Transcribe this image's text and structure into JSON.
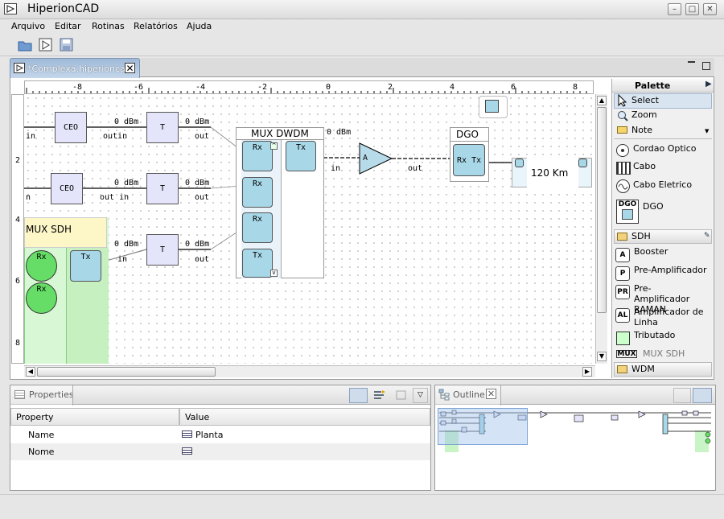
{
  "window": {
    "title": "HiperionCAD"
  },
  "menu": {
    "items": [
      "Arquivo",
      "Editar",
      "Rotinas",
      "Relatórios",
      "Ajuda"
    ]
  },
  "editor": {
    "tab_label": "*Complexa.hiperioncad"
  },
  "ruler": {
    "h_ticks": [
      "-8",
      "-6",
      "-4",
      "-2",
      "0",
      "2",
      "4",
      "6",
      "8"
    ],
    "v_ticks": [
      "2",
      "4",
      "6",
      "8"
    ]
  },
  "diagram": {
    "ceo_label": "CEO",
    "t_label": "T",
    "power": "0 dBm",
    "in": "in",
    "out": "out",
    "outin": "outin",
    "out_in": "out in",
    "n": "n",
    "mux_dwdm": "MUX DWDM",
    "mux_sdh": "MUX SDH",
    "rx": "Rx",
    "tx": "Tx",
    "amp": "A",
    "dgo": "DGO",
    "fiber": "120 Km"
  },
  "palette": {
    "title": "Palette",
    "tools": [
      "Select",
      "Zoom",
      "Note"
    ],
    "items": [
      "Cordao Optico",
      "Cabo",
      "Cabo Eletrico",
      "DGO"
    ],
    "drawer_sdh": "SDH",
    "sdh_items": [
      "Booster",
      "Pre-Amplificador",
      "Pre-Amplificador RAMAN",
      "Amplificador de Linha",
      "Tributado",
      "MUX SDH"
    ],
    "drawer_wdm": "WDM",
    "icon_letters": {
      "booster": "A",
      "pre": "P",
      "raman": "PR",
      "linha": "AL",
      "mux": "MUX",
      "dgo": "DGO"
    }
  },
  "properties": {
    "title": "Properties",
    "col_property": "Property",
    "col_value": "Value",
    "rows": [
      {
        "name": "Name",
        "value": "Planta"
      },
      {
        "name": "Nome",
        "value": ""
      }
    ]
  },
  "outline": {
    "title": "Outline"
  },
  "colors": {
    "block": "#e4e4fa",
    "rx": "#a8d8e8",
    "sdh_green": "#66dd66",
    "note": "#fdf7c8",
    "tab": "#9fb9d8"
  }
}
